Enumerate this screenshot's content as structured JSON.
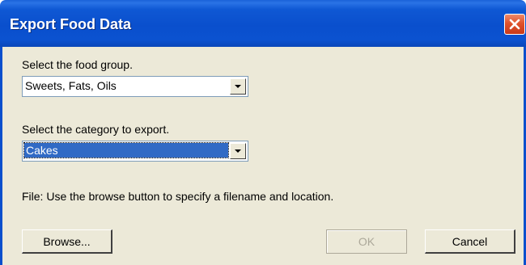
{
  "window": {
    "title": "Export Food Data",
    "close_icon": "close-icon"
  },
  "food_group": {
    "label": "Select the food group.",
    "selected": "Sweets, Fats, Oils"
  },
  "category": {
    "label": "Select the category to export.",
    "selected": "Cakes"
  },
  "file_hint": "File: Use the browse button to specify a filename and location.",
  "buttons": {
    "browse": "Browse...",
    "ok": "OK",
    "cancel": "Cancel"
  },
  "colors": {
    "titlebar": "#0a4fcd",
    "close": "#e0522b",
    "client": "#ece9d8",
    "selection": "#316ac5"
  }
}
